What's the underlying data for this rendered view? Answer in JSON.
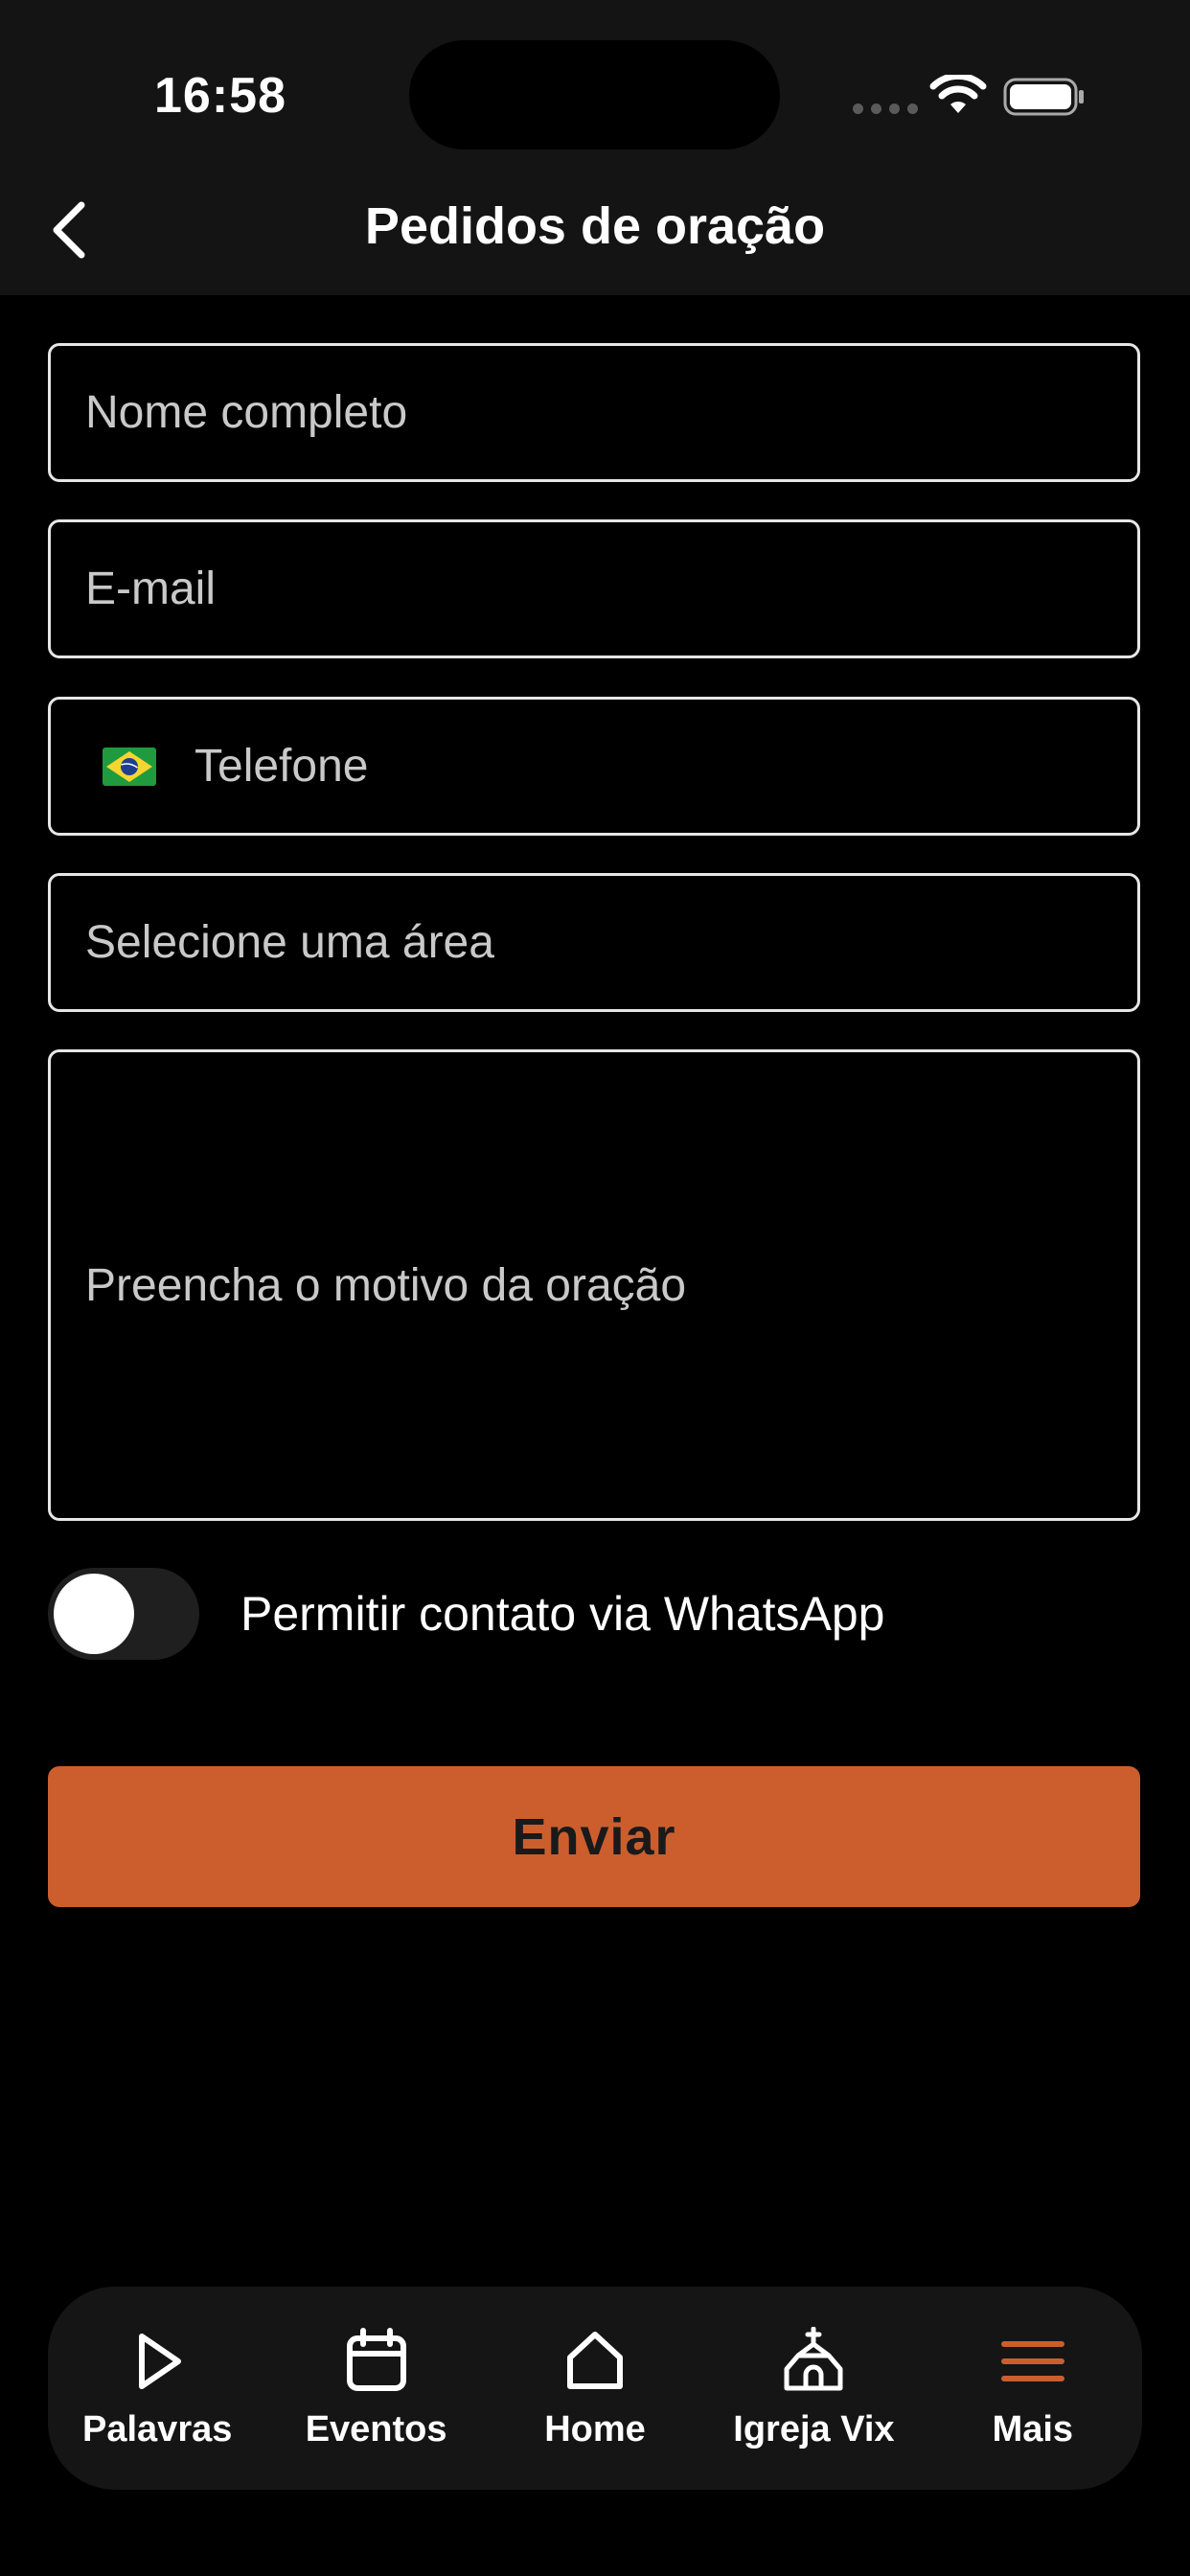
{
  "status_bar": {
    "time": "16:58"
  },
  "header": {
    "title": "Pedidos de oração",
    "back_icon": "chevron-left-icon"
  },
  "form": {
    "name_placeholder": "Nome completo",
    "email_placeholder": "E-mail",
    "phone_placeholder": "Telefone",
    "phone_flag_icon": "brazil-flag-icon",
    "area_placeholder": "Selecione uma área",
    "reason_placeholder": "Preencha o motivo da oração",
    "whatsapp_label": "Permitir contato via WhatsApp",
    "whatsapp_enabled": false,
    "submit_label": "Enviar"
  },
  "tabbar": {
    "items": [
      {
        "label": "Palavras",
        "icon": "play-icon",
        "active": false
      },
      {
        "label": "Eventos",
        "icon": "calendar-icon",
        "active": false
      },
      {
        "label": "Home",
        "icon": "home-icon",
        "active": false
      },
      {
        "label": "Igreja Vix",
        "icon": "church-icon",
        "active": false
      },
      {
        "label": "Mais",
        "icon": "menu-icon",
        "active": true
      }
    ]
  },
  "colors": {
    "accent": "#cc5e2e",
    "background": "#000000",
    "header_bg": "#141414",
    "field_border": "#e6e6e6",
    "placeholder": "#c9c9c9"
  }
}
